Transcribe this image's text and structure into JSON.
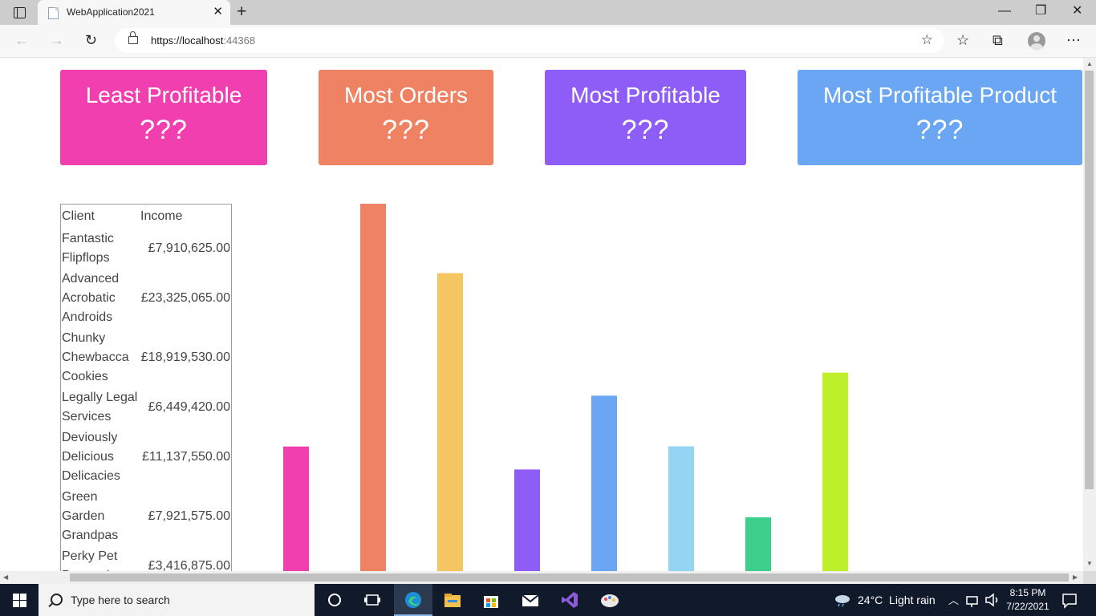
{
  "browser": {
    "tab_title": "WebApplication2021",
    "url_host": "https://localhost",
    "url_port": ":44368"
  },
  "cards": {
    "least_profitable": {
      "title": "Least Profitable",
      "value": "???"
    },
    "most_orders": {
      "title": "Most Orders",
      "value": "???"
    },
    "most_profitable": {
      "title": "Most Profitable",
      "value": "???"
    },
    "most_profitable_product": {
      "title": "Most Profitable Product",
      "value": "???"
    }
  },
  "table": {
    "headers": [
      "Client",
      "Income"
    ],
    "rows": [
      {
        "client": "Fantastic Flipflops",
        "income": "£7,910,625.00"
      },
      {
        "client": "Advanced Acrobatic Androids",
        "income": "£23,325,065.00"
      },
      {
        "client": "Chunky Chewbacca Cookies",
        "income": "£18,919,530.00"
      },
      {
        "client": "Legally Legal Services",
        "income": "£6,449,420.00"
      },
      {
        "client": "Deviously Delicious Delicacies",
        "income": "£11,137,550.00"
      },
      {
        "client": "Green Garden Grandpas",
        "income": "£7,921,575.00"
      },
      {
        "client": "Perky Pet Pampering",
        "income": "£3,416,875.00"
      }
    ]
  },
  "chart_data": {
    "type": "bar",
    "values": [
      7910625,
      23325065,
      18919530,
      6449420,
      11137550,
      7921575,
      3416875,
      12600000
    ],
    "colors": [
      "#f23fb0",
      "#ee8263",
      "#f4c562",
      "#8e5cf6",
      "#6aa6f3",
      "#93d5f3",
      "#3ccf8e",
      "#bdef2b"
    ],
    "ylim": [
      0,
      23325065
    ],
    "grid": false
  },
  "taskbar": {
    "search_placeholder": "Type here to search",
    "weather": "24°C  Light rain",
    "time": "8:15 PM",
    "date": "7/22/2021"
  }
}
